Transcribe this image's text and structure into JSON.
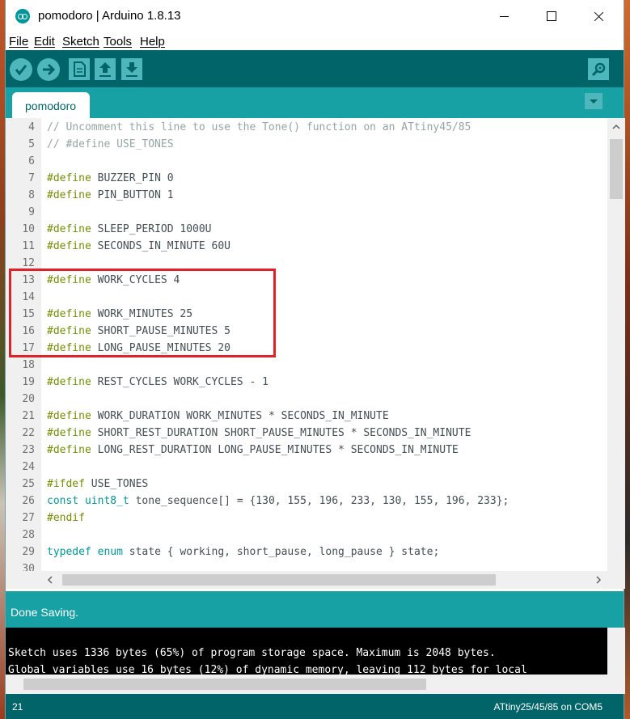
{
  "window": {
    "title": "pomodoro | Arduino 1.8.13"
  },
  "menu": {
    "items": [
      "File",
      "Edit",
      "Sketch",
      "Tools",
      "Help"
    ]
  },
  "toolbar": {
    "buttons": [
      "verify",
      "upload",
      "new",
      "open",
      "save",
      "serial-monitor"
    ],
    "icons": {
      "verify": "checkmark-icon",
      "upload": "arrow-right-icon",
      "new": "document-icon",
      "open": "arrow-up-icon",
      "save": "arrow-down-icon",
      "serial-monitor": "magnifier-icon"
    }
  },
  "tabs": [
    {
      "label": "pomodoro",
      "active": true
    }
  ],
  "editor": {
    "lines": [
      {
        "n": "4",
        "text": "// Uncomment this line to use the Tone() function on an ATtiny45/85"
      },
      {
        "n": "5",
        "text": "// #define USE_TONES"
      },
      {
        "n": "6",
        "text": ""
      },
      {
        "n": "7",
        "text": "#define BUZZER_PIN 0"
      },
      {
        "n": "8",
        "text": "#define PIN_BUTTON 1"
      },
      {
        "n": "9",
        "text": ""
      },
      {
        "n": "10",
        "text": "#define SLEEP_PERIOD 1000U"
      },
      {
        "n": "11",
        "text": "#define SECONDS_IN_MINUTE 60U"
      },
      {
        "n": "12",
        "text": ""
      },
      {
        "n": "13",
        "text": "#define WORK_CYCLES 4"
      },
      {
        "n": "14",
        "text": ""
      },
      {
        "n": "15",
        "text": "#define WORK_MINUTES 25"
      },
      {
        "n": "16",
        "text": "#define SHORT_PAUSE_MINUTES 5"
      },
      {
        "n": "17",
        "text": "#define LONG_PAUSE_MINUTES 20"
      },
      {
        "n": "18",
        "text": ""
      },
      {
        "n": "19",
        "text": "#define REST_CYCLES WORK_CYCLES - 1"
      },
      {
        "n": "20",
        "text": ""
      },
      {
        "n": "21",
        "text": "#define WORK_DURATION WORK_MINUTES * SECONDS_IN_MINUTE"
      },
      {
        "n": "22",
        "text": "#define SHORT_REST_DURATION SHORT_PAUSE_MINUTES * SECONDS_IN_MINUTE"
      },
      {
        "n": "23",
        "text": "#define LONG_REST_DURATION LONG_PAUSE_MINUTES * SECONDS_IN_MINUTE"
      },
      {
        "n": "24",
        "text": ""
      },
      {
        "n": "25",
        "text": "#ifdef USE_TONES"
      },
      {
        "n": "26",
        "text": "const uint8_t tone_sequence[] = {130, 155, 196, 233, 130, 155, 196, 233};"
      },
      {
        "n": "27",
        "text": "#endif"
      },
      {
        "n": "28",
        "text": ""
      },
      {
        "n": "29",
        "text": "typedef enum state { working, short_pause, long_pause } state;"
      },
      {
        "n": "30",
        "text": ""
      }
    ]
  },
  "status": {
    "message": "Done Saving."
  },
  "console": {
    "lines": [
      "Sketch uses 1336 bytes (65%) of program storage space. Maximum is 2048 bytes.",
      "Global variables use 16 bytes (12%) of dynamic memory, leaving 112 bytes for local"
    ]
  },
  "footer": {
    "line_number": "21",
    "board": "ATtiny25/45/85 on COM5"
  },
  "colors": {
    "toolbar_dark": "#006468",
    "teal": "#17a1a5",
    "button": "#4db7bb",
    "keyword": "#728e00",
    "type": "#00979c",
    "comment": "#95a5a6",
    "highlight": "#e12127"
  }
}
